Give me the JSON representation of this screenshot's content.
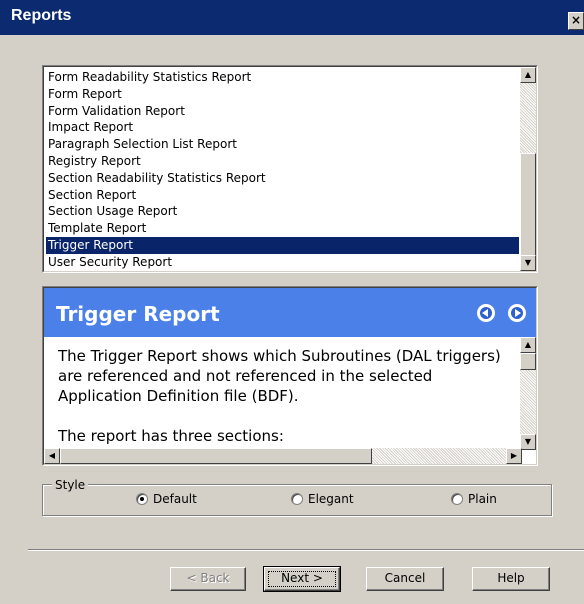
{
  "window": {
    "title": "Reports",
    "close_label": "×"
  },
  "report_list": {
    "items": [
      "Form Readability Statistics Report",
      "Form Report",
      "Form Validation Report",
      "Impact Report",
      "Paragraph Selection List Report",
      "Registry Report",
      "Section Readability Statistics Report",
      "Section Report",
      "Section Usage Report",
      "Template Report",
      "Trigger Report",
      "User Security Report"
    ],
    "selected": "Trigger Report"
  },
  "help": {
    "title": "Trigger Report",
    "paragraph1": "The Trigger Report shows which Subroutines (DAL triggers) are referenced and not referenced in the selected Application Definition file (BDF).",
    "paragraph2": "The report has three sections:",
    "back_icon": "circle-arrow-left-icon",
    "forward_icon": "circle-arrow-right-icon"
  },
  "style_group": {
    "label": "Style",
    "options": [
      {
        "label": "Default",
        "checked": true
      },
      {
        "label": "Elegant",
        "checked": false
      },
      {
        "label": "Plain",
        "checked": false
      }
    ]
  },
  "buttons": {
    "back": "< Back",
    "next": "Next >",
    "cancel": "Cancel",
    "help": "Help"
  },
  "colors": {
    "titlebar": "#0b2a6f",
    "selection": "#0a246a",
    "help_header": "#4a80e8",
    "dialog_face": "#d4d0c8"
  }
}
